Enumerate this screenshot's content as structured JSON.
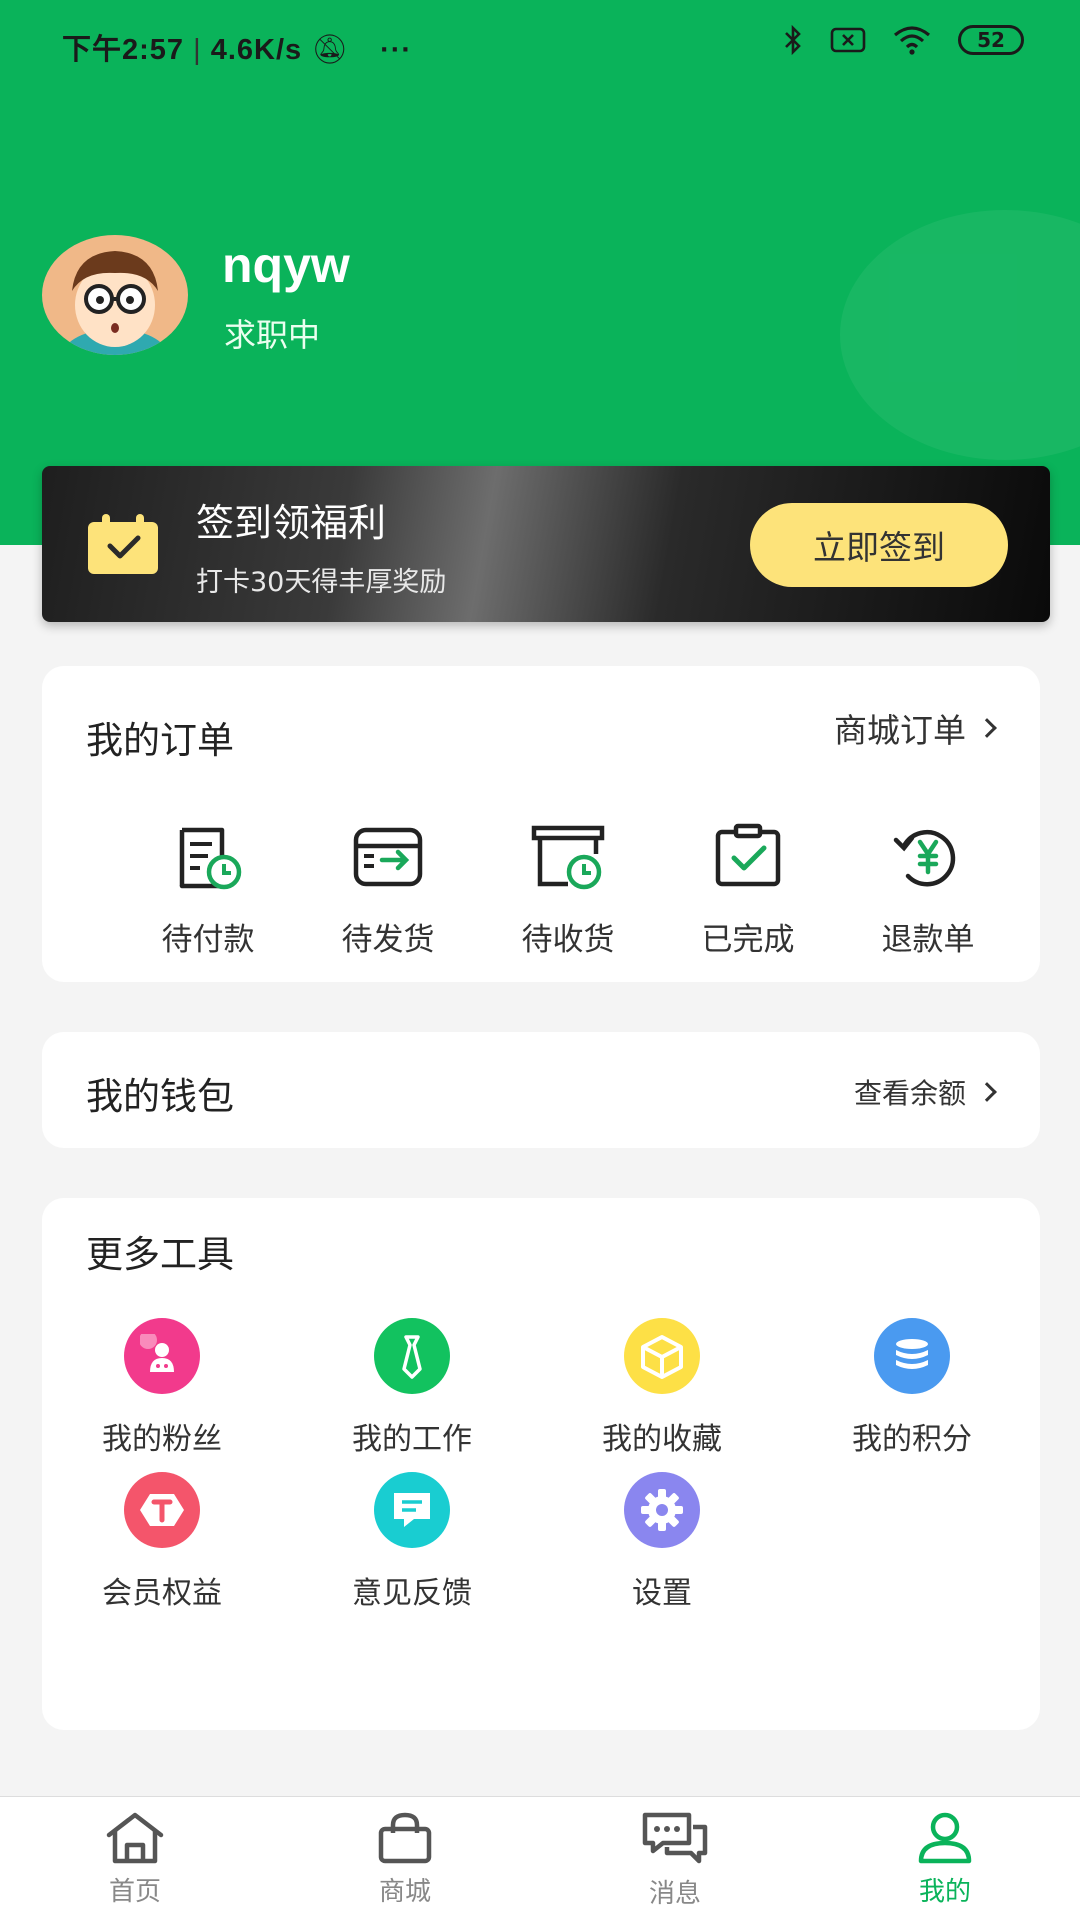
{
  "status_bar": {
    "time": "下午2:57",
    "speed": "4.6K/s",
    "dots": "···",
    "battery": "52"
  },
  "profile": {
    "username": "nqyw",
    "status": "求职中"
  },
  "signin": {
    "title": "签到领福利",
    "subtitle": "打卡30天得丰厚奖励",
    "button": "立即签到"
  },
  "orders": {
    "title": "我的订单",
    "link": "商城订单",
    "items": [
      {
        "label": "待付款",
        "icon": "pending-payment-icon"
      },
      {
        "label": "待发货",
        "icon": "pending-shipment-icon"
      },
      {
        "label": "待收货",
        "icon": "pending-receipt-icon"
      },
      {
        "label": "已完成",
        "icon": "completed-icon"
      },
      {
        "label": "退款单",
        "icon": "refund-icon"
      }
    ]
  },
  "wallet": {
    "title": "我的钱包",
    "link": "查看余额"
  },
  "tools": {
    "title": "更多工具",
    "items": [
      {
        "label": "我的粉丝",
        "icon": "fans-icon",
        "color": "#f23a8c"
      },
      {
        "label": "我的工作",
        "icon": "tie-icon",
        "color": "#12c25f"
      },
      {
        "label": "我的收藏",
        "icon": "box-icon",
        "color": "#fde046"
      },
      {
        "label": "我的积分",
        "icon": "coins-icon",
        "color": "#4a9af0"
      },
      {
        "label": "会员权益",
        "icon": "member-icon",
        "color": "#f4556b"
      },
      {
        "label": "意见反馈",
        "icon": "feedback-icon",
        "color": "#19cdd1"
      },
      {
        "label": "设置",
        "icon": "gear-icon",
        "color": "#8a86ef"
      }
    ]
  },
  "tabbar": {
    "items": [
      {
        "label": "首页",
        "icon": "home-icon",
        "active": false
      },
      {
        "label": "商城",
        "icon": "shop-bag-icon",
        "active": false
      },
      {
        "label": "消息",
        "icon": "message-icon",
        "active": false
      },
      {
        "label": "我的",
        "icon": "user-icon",
        "active": true
      }
    ]
  },
  "colors": {
    "brand_green": "#0ab35a",
    "signin_button": "#fde37a"
  }
}
